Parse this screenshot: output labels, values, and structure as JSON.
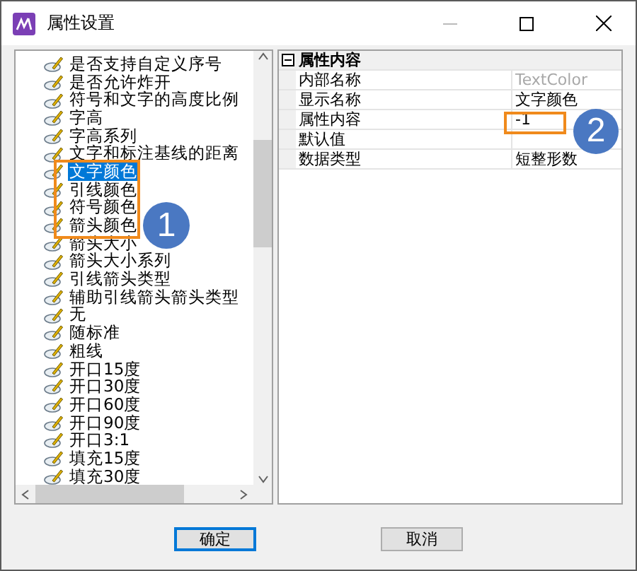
{
  "window": {
    "title": "属性设置"
  },
  "tree": {
    "items": [
      {
        "label": "是否支持自定义序号",
        "selected": false
      },
      {
        "label": "是否允许炸开",
        "selected": false
      },
      {
        "label": "符号和文字的高度比例",
        "selected": false
      },
      {
        "label": "字高",
        "selected": false
      },
      {
        "label": "字高系列",
        "selected": false
      },
      {
        "label": "文字和标注基线的距离",
        "selected": false
      },
      {
        "label": "文字颜色",
        "selected": true
      },
      {
        "label": "引线颜色",
        "selected": false
      },
      {
        "label": "符号颜色",
        "selected": false
      },
      {
        "label": "箭头颜色",
        "selected": false
      },
      {
        "label": "箭头大小",
        "selected": false
      },
      {
        "label": "箭头大小系列",
        "selected": false
      },
      {
        "label": "引线箭头类型",
        "selected": false
      },
      {
        "label": "辅助引线箭头箭头类型",
        "selected": false
      },
      {
        "label": "无",
        "selected": false
      },
      {
        "label": "随标准",
        "selected": false
      },
      {
        "label": "粗线",
        "selected": false
      },
      {
        "label": "开口15度",
        "selected": false
      },
      {
        "label": "开口30度",
        "selected": false
      },
      {
        "label": "开口60度",
        "selected": false
      },
      {
        "label": "开口90度",
        "selected": false
      },
      {
        "label": "开口3:1",
        "selected": false
      },
      {
        "label": "填充15度",
        "selected": false
      },
      {
        "label": "填充30度",
        "selected": false
      }
    ]
  },
  "properties": {
    "group": "属性内容",
    "expanded": true,
    "rows": [
      {
        "kind": "readonly",
        "name": "内部名称",
        "value": "TextColor"
      },
      {
        "kind": "editable",
        "name": "显示名称",
        "value": "文字颜色"
      },
      {
        "kind": "editable",
        "name": "属性内容",
        "value": "-1"
      },
      {
        "kind": "empty",
        "name": "默认值"
      },
      {
        "kind": "editable",
        "name": "数据类型",
        "value": "短整形数"
      }
    ]
  },
  "buttons": [
    {
      "label": "确定",
      "default": true
    },
    {
      "label": "取消",
      "default": false
    }
  ],
  "callouts": [
    {
      "label": "1"
    },
    {
      "label": "2"
    }
  ]
}
